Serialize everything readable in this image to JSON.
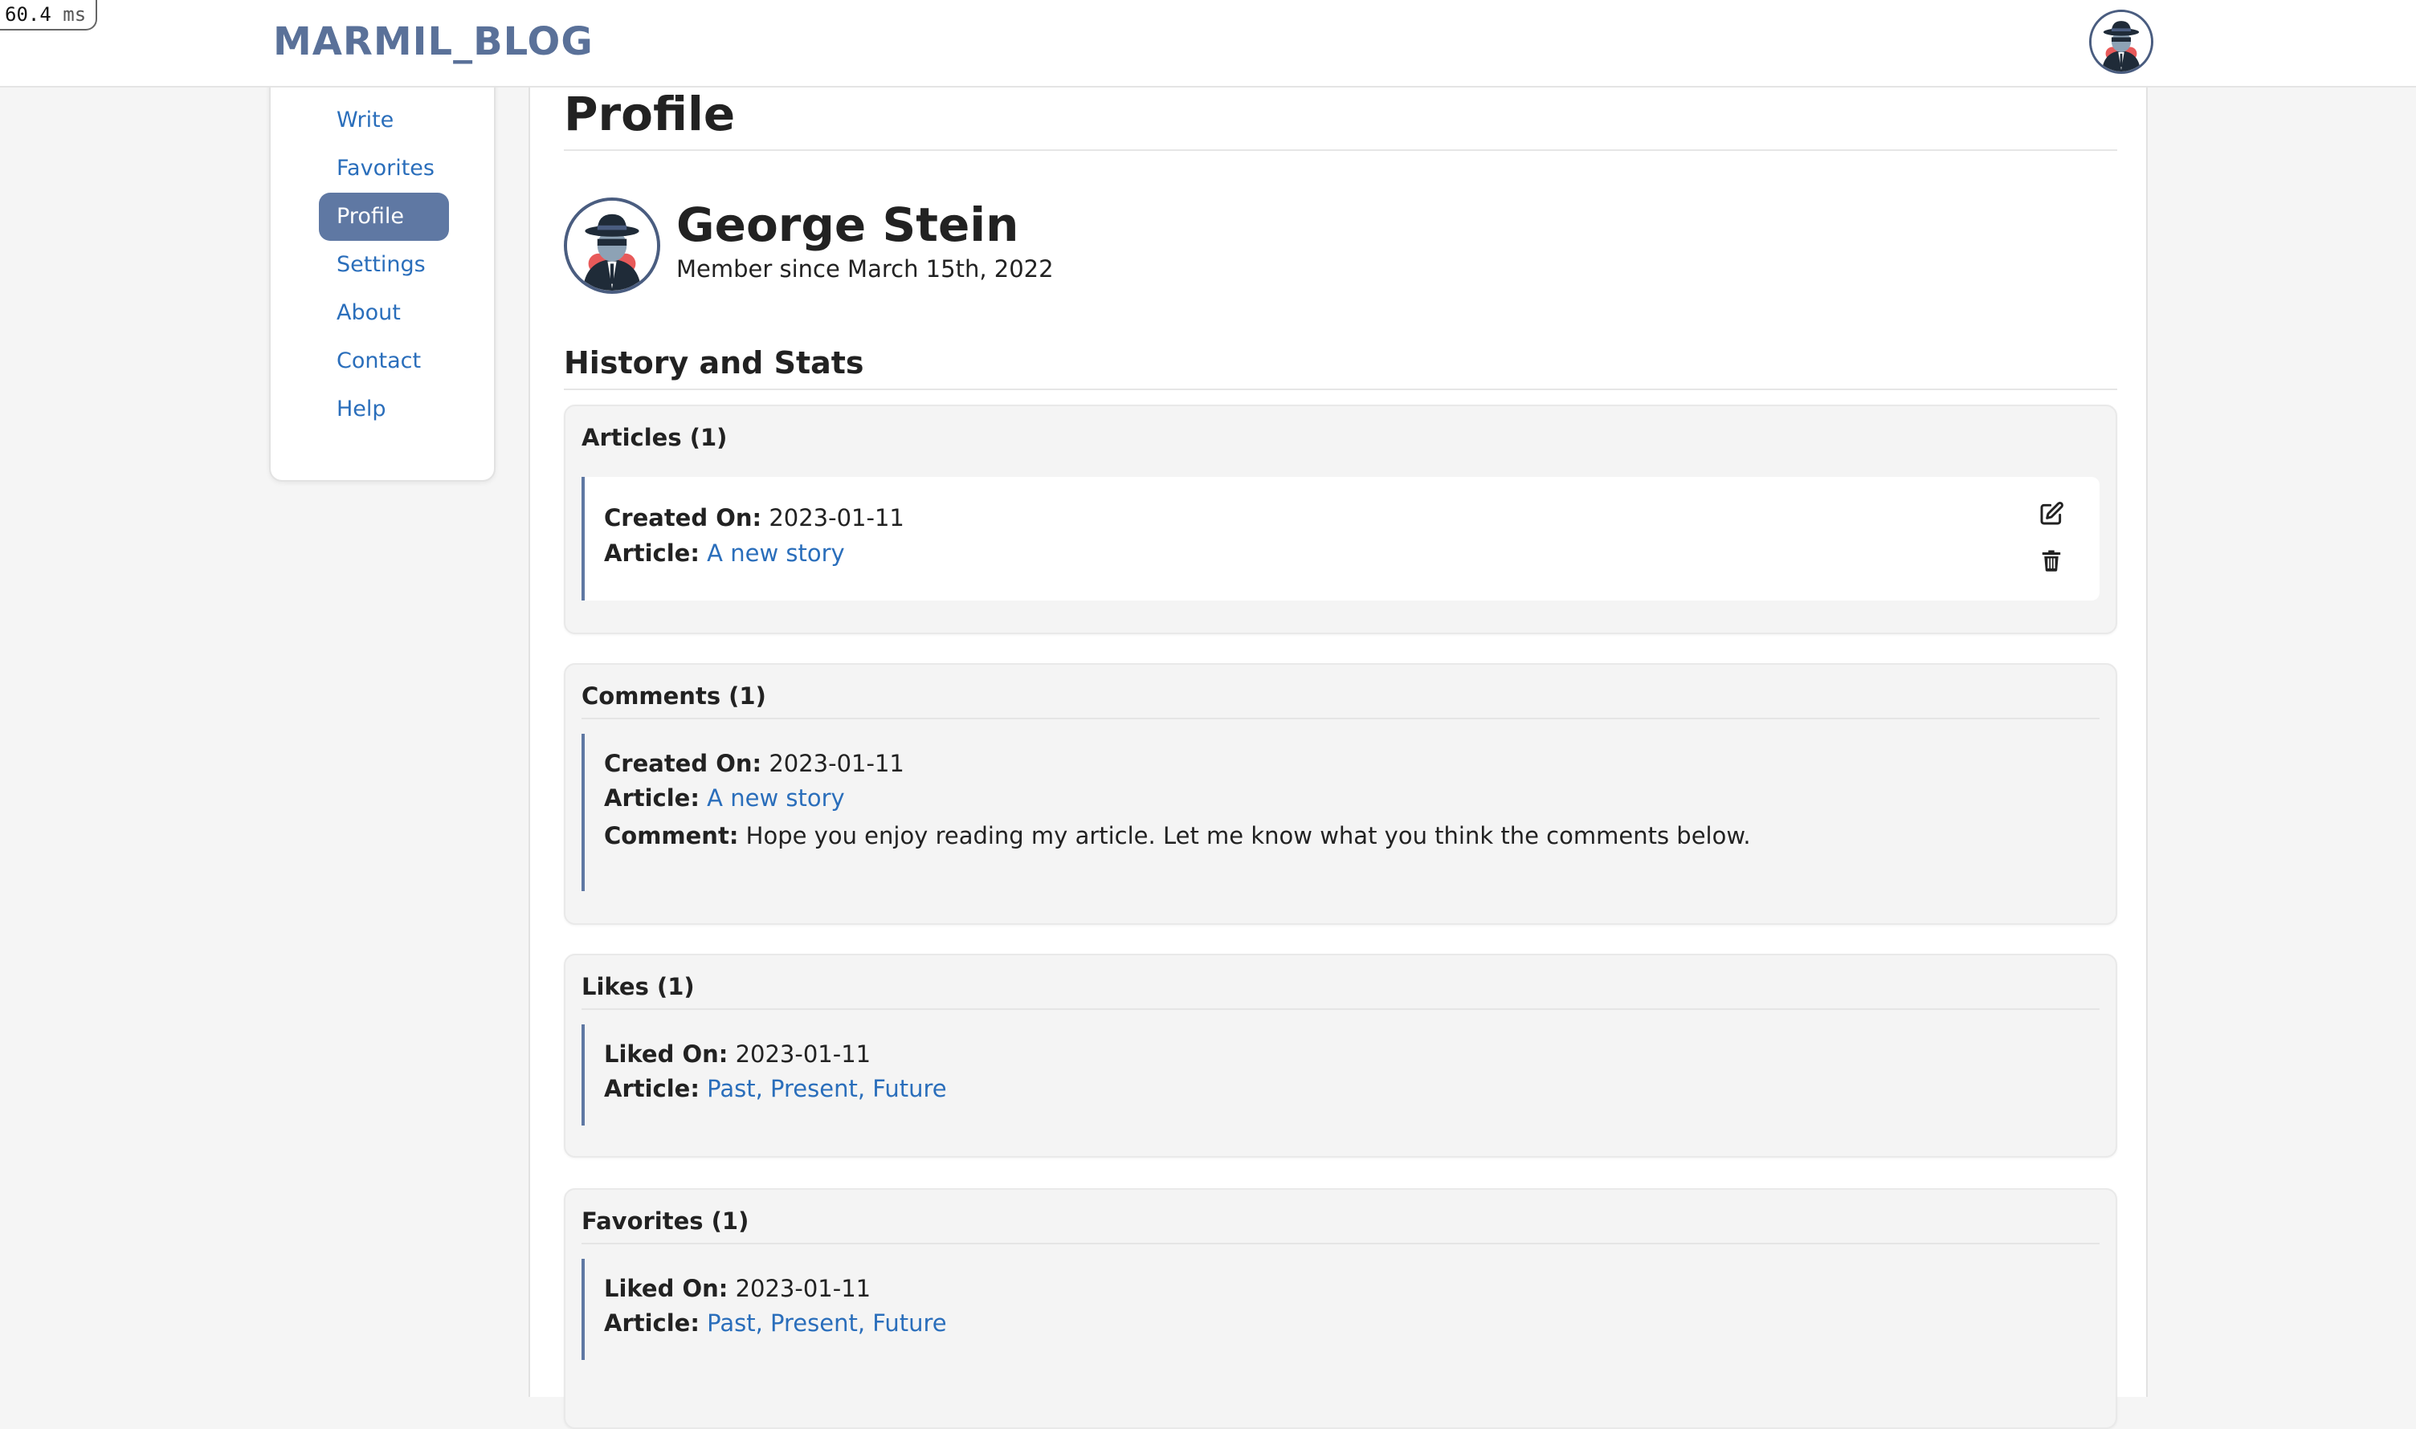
{
  "timer": {
    "value": "60.4",
    "unit": "ms"
  },
  "header": {
    "brand": "MARMIL_BLOG"
  },
  "sidebar": {
    "items": [
      {
        "label": "Write"
      },
      {
        "label": "Favorites"
      },
      {
        "label": "Profile",
        "active": true
      },
      {
        "label": "Settings"
      },
      {
        "label": "About"
      },
      {
        "label": "Contact"
      },
      {
        "label": "Help"
      }
    ]
  },
  "main": {
    "title": "Profile",
    "profile": {
      "name": "George Stein",
      "member_since": "Member since March 15th, 2022"
    },
    "section_title": "History and Stats",
    "articles": {
      "title": "Articles (1)",
      "created_label": "Created On:",
      "created_value": "2023-01-11",
      "article_label": "Article:",
      "article_value": "A new story"
    },
    "comments": {
      "title": "Comments (1)",
      "created_label": "Created On:",
      "created_value": "2023-01-11",
      "article_label": "Article:",
      "article_value": "A new story",
      "comment_label": "Comment:",
      "comment_value": "Hope you enjoy reading my article. Let me know what you think the comments below."
    },
    "likes": {
      "title": "Likes (1)",
      "liked_label": "Liked On:",
      "liked_value": "2023-01-11",
      "article_label": "Article:",
      "article_value": "Past, Present, Future"
    },
    "favorites": {
      "title": "Favorites (1)",
      "liked_label": "Liked On:",
      "liked_value": "2023-01-11",
      "article_label": "Article:",
      "article_value": "Past, Present, Future"
    }
  },
  "colors": {
    "brand": "#5a7199",
    "accent": "#5f78a3",
    "link": "#2a6ebb"
  },
  "icons": [
    "user-avatar-icon",
    "edit-icon",
    "trash-icon"
  ]
}
